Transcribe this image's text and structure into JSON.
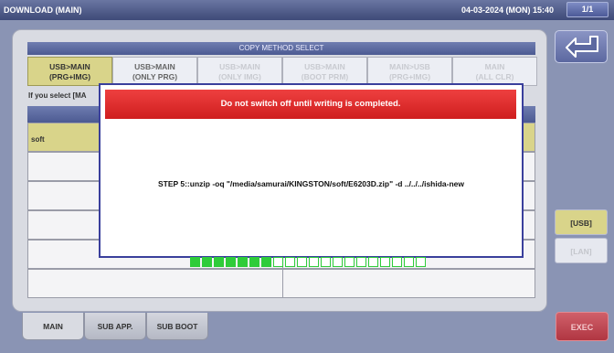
{
  "window": {
    "title": "DOWNLOAD (MAIN)",
    "datetime": "04-03-2024 (MON) 15:40",
    "page": "1/1"
  },
  "copy_method": {
    "header": "COPY METHOD SELECT",
    "buttons": [
      {
        "line1": "USB>MAIN",
        "line2": "(PRG+IMG)",
        "state": "active"
      },
      {
        "line1": "USB>MAIN",
        "line2": "(ONLY PRG)",
        "state": "normal"
      },
      {
        "line1": "USB>MAIN",
        "line2": "(ONLY IMG)",
        "state": "disabled"
      },
      {
        "line1": "USB>MAIN",
        "line2": "(BOOT PRM)",
        "state": "disabled"
      },
      {
        "line1": "MAIN>USB",
        "line2": "(PRG+IMG)",
        "state": "disabled"
      },
      {
        "line1": "MAIN",
        "line2": "(ALL CLR)",
        "state": "disabled"
      }
    ],
    "info_text": "If you select [MA"
  },
  "file_list": {
    "rows": [
      {
        "name": "soft",
        "selected": true
      },
      {
        "name": "",
        "selected": false
      },
      {
        "name": "",
        "selected": false
      },
      {
        "name": "",
        "selected": false
      },
      {
        "name": "",
        "selected": false
      },
      {
        "name": "",
        "selected": false
      }
    ]
  },
  "tabs": [
    {
      "label": "MAIN",
      "active": true
    },
    {
      "label": "SUB APP.",
      "active": false
    },
    {
      "label": "SUB BOOT",
      "active": false
    }
  ],
  "side": {
    "back_icon": "return-arrow-icon",
    "usb_label": "[USB]",
    "lan_label": "[LAN]",
    "exec_label": "EXEC"
  },
  "dialog": {
    "warning": "Do not switch off until writing is completed.",
    "step": "STEP 5::unzip -oq \"/media/samurai/KINGSTON/soft/E6203D.zip\" -d ../../../ishida-new",
    "progress": {
      "filled": 7,
      "total": 20
    }
  },
  "colors": {
    "active": "#d9d48a",
    "warning": "#e22c2c",
    "progress": "#2ecc3a",
    "exec": "#c04450"
  }
}
